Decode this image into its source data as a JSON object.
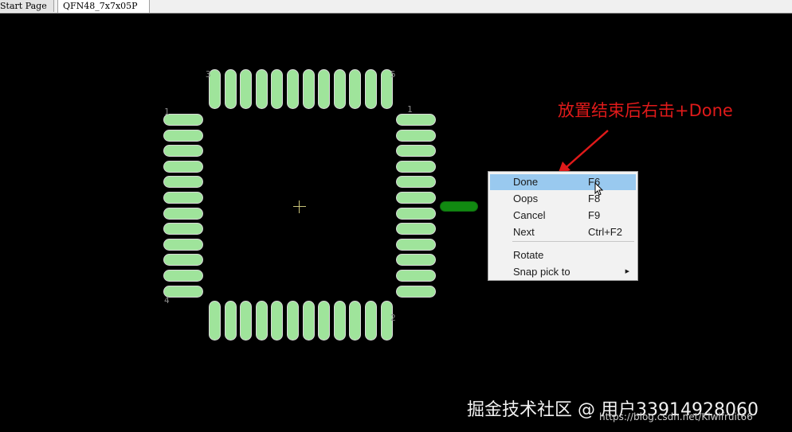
{
  "tabs": [
    {
      "label": "Start Page"
    },
    {
      "label": "QFN48_7x7x05P"
    }
  ],
  "pin_labels": {
    "top_left": "3",
    "top_right": "5",
    "left_top": "1",
    "right_top": "1",
    "bottom_right": "2",
    "left_bottom": "4"
  },
  "context_menu": {
    "items": [
      {
        "label": "Done",
        "shortcut": "F6",
        "selected": true
      },
      {
        "label": "Oops",
        "shortcut": "F8"
      },
      {
        "label": "Cancel",
        "shortcut": "F9"
      },
      {
        "label": "Next",
        "shortcut": "Ctrl+F2"
      },
      {
        "label": "Rotate",
        "shortcut": ""
      },
      {
        "label": "Snap pick to",
        "shortcut": "",
        "submenu": true
      }
    ]
  },
  "annotation": {
    "text": "放置结束后右击+Done",
    "color": "#e01a1a"
  },
  "watermark": {
    "main": "掘金技术社区 @ 用户33914928060",
    "url": "https://blog.csdn.net/Kiwifruit66"
  },
  "colors": {
    "pad_fill": "#9fe49b",
    "placing_pad": "#118a11",
    "canvas_bg": "#000000",
    "menu_highlight": "#99c9ef"
  }
}
